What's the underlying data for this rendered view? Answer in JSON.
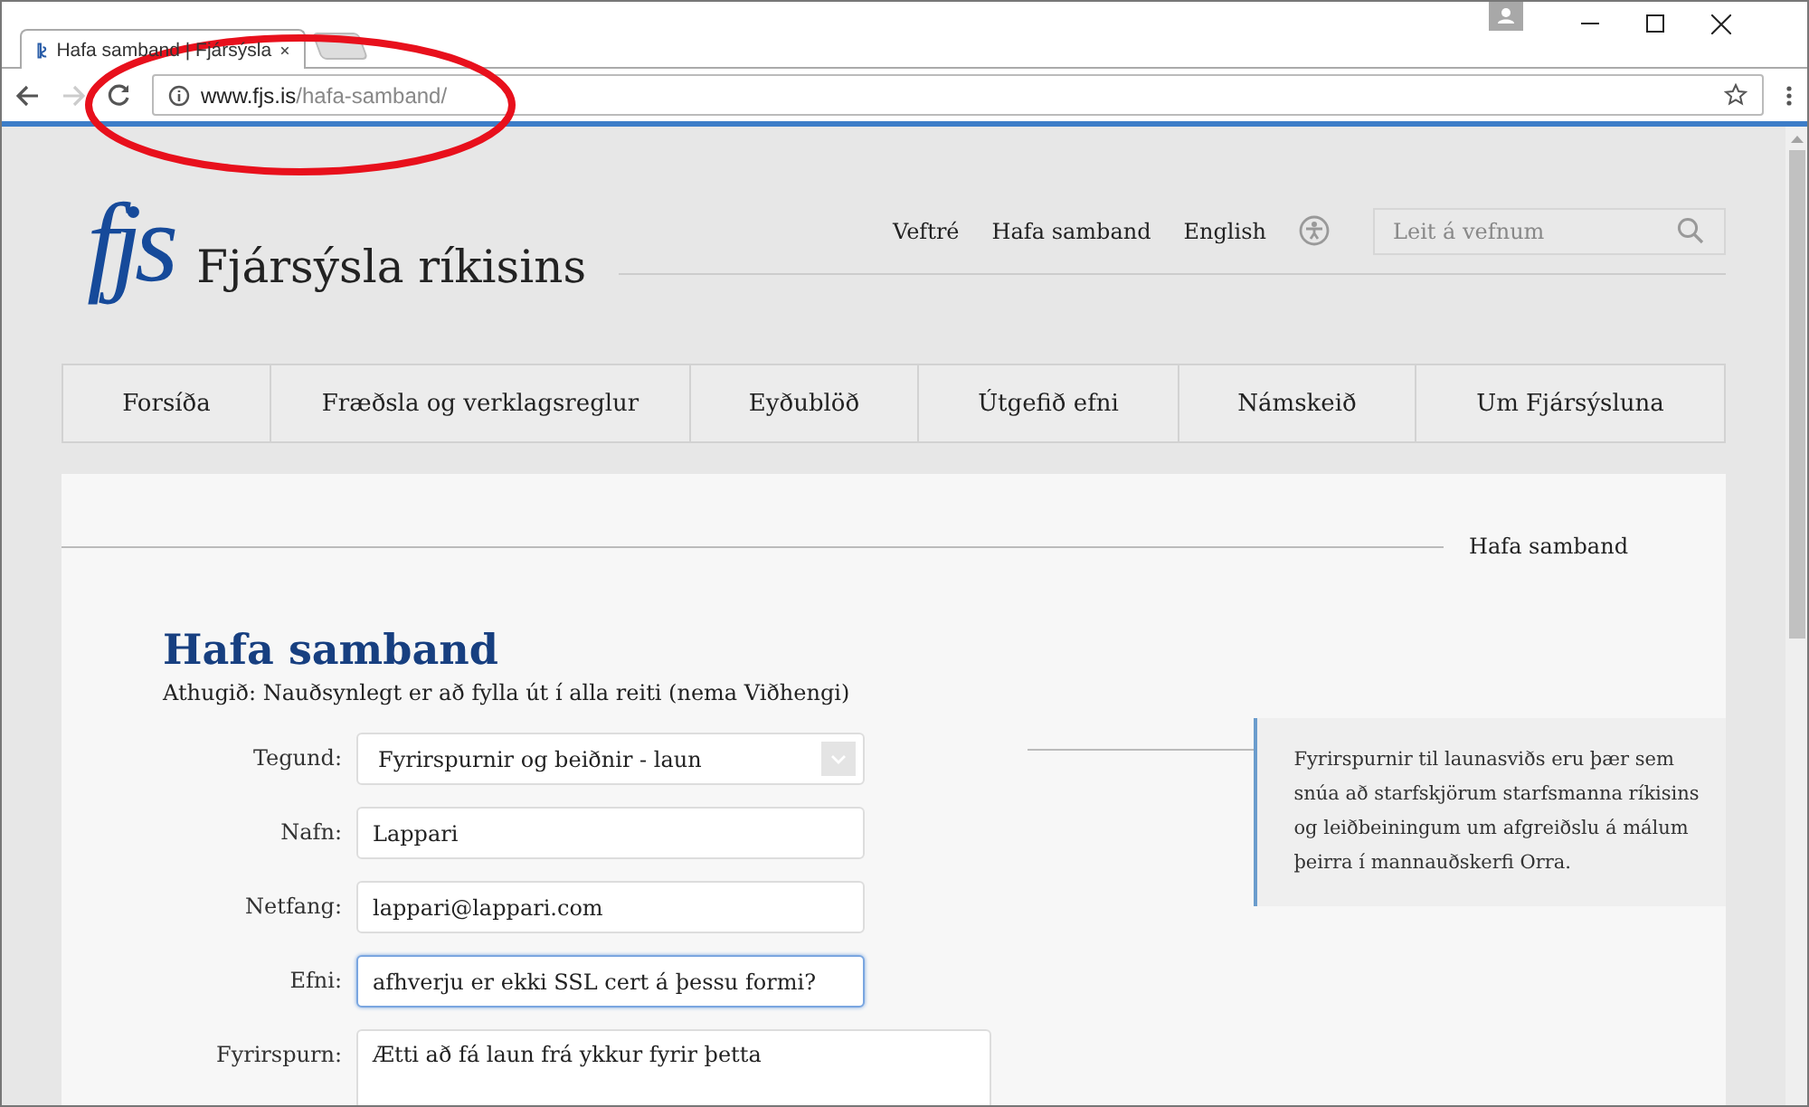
{
  "browser": {
    "tabs": [
      {
        "title": "Hafa samband | Fjársýsla",
        "selected": true
      },
      {
        "selected": false
      }
    ],
    "url_host": "www.fjs.is",
    "url_path": "/hafa-samband/"
  },
  "site": {
    "logo_text": "fjs",
    "name": "Fjársýsla ríkisins",
    "top_links": [
      "Veftré",
      "Hafa samband",
      "English"
    ],
    "search": {
      "placeholder": "Leit á vefnum"
    },
    "nav": [
      {
        "label": "Forsíða"
      },
      {
        "label": "Fræðsla og verklagsreglur"
      },
      {
        "label": "Eyðublöð"
      },
      {
        "label": "Útgefið efni"
      },
      {
        "label": "Námskeið"
      },
      {
        "label": "Um Fjársýsluna"
      }
    ]
  },
  "breadcrumb": "Hafa samband",
  "heading": "Hafa samband",
  "note": "Athugið: Nauðsynlegt er að fylla út í alla reiti (nema Viðhengi)",
  "form": [
    {
      "kind": "select",
      "label": "Tegund:",
      "value": "Fyrirspurnir og beiðnir - laun",
      "focused": false
    },
    {
      "kind": "text",
      "label": "Nafn:",
      "value": "Lappari",
      "focused": false
    },
    {
      "kind": "text",
      "label": "Netfang:",
      "value": "lappari@lappari.com",
      "focused": false
    },
    {
      "kind": "text",
      "label": "Efni:",
      "value": "afhverju er ekki SSL cert á þessu formi?",
      "focused": true
    },
    {
      "kind": "textarea",
      "label": "Fyrirspurn:",
      "value": "Ætti að fá laun frá ykkur fyrir þetta",
      "focused": false
    }
  ],
  "info_box": "Fyrirspurnir til launasviðs eru þær sem snúa að starfskjörum starfsmanna ríkisins og leiðbeiningum um afgreiðslu á málum þeirra í mannauðskerfi Orra."
}
